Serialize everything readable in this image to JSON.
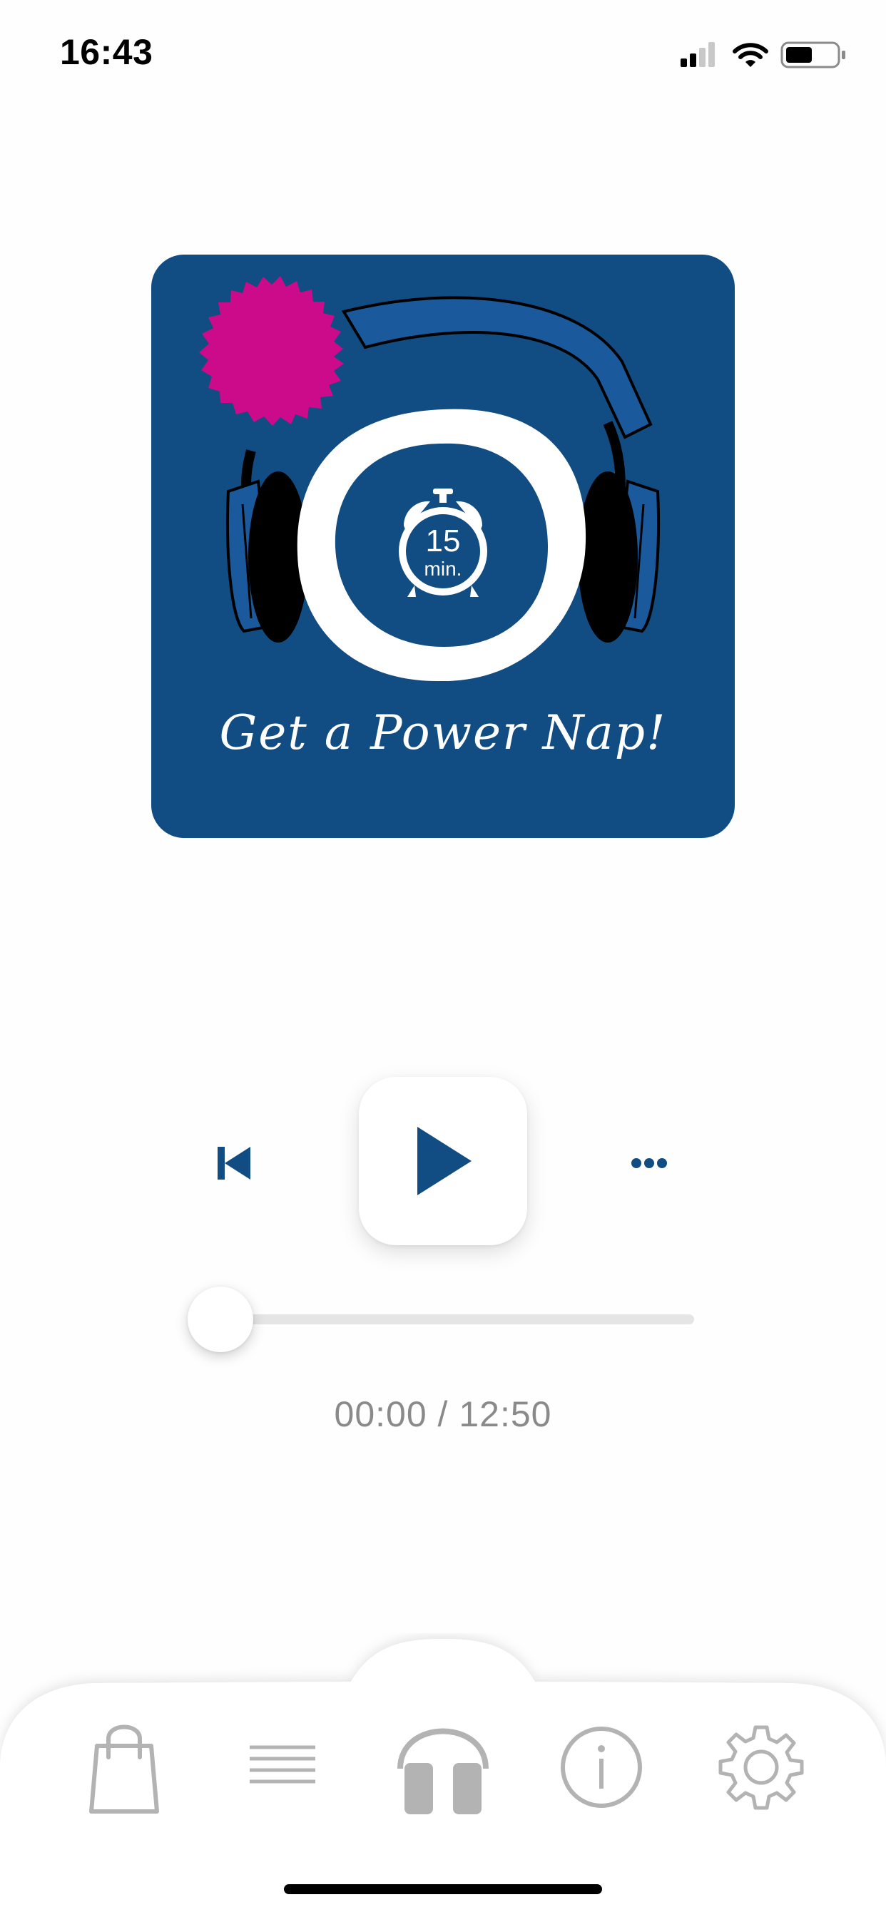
{
  "status_bar": {
    "time": "16:43",
    "signal_icon": "cellular-signal-icon",
    "wifi_icon": "wifi-icon",
    "battery_icon": "battery-icon"
  },
  "artwork": {
    "title": "Get a Power Nap!",
    "timer_number": "15",
    "timer_unit": "min.",
    "background_color": "#114c82",
    "badge_color": "#cb0b89",
    "headphones_color": "#1a5a9c"
  },
  "player": {
    "prev_icon": "skip-to-start-icon",
    "play_icon": "play-icon",
    "more_icon": "more-options-icon",
    "progress_fraction": 0,
    "elapsed": "00:00",
    "separator": " / ",
    "duration": "12:50",
    "accent_color": "#114c82"
  },
  "tab_bar": {
    "items": [
      {
        "name": "shop",
        "icon": "shopping-bag-icon"
      },
      {
        "name": "list",
        "icon": "list-icon"
      },
      {
        "name": "player",
        "icon": "headphones-icon",
        "active": true
      },
      {
        "name": "info",
        "icon": "info-icon"
      },
      {
        "name": "settings",
        "icon": "gear-icon"
      }
    ],
    "icon_color": "#b3b3b3"
  }
}
